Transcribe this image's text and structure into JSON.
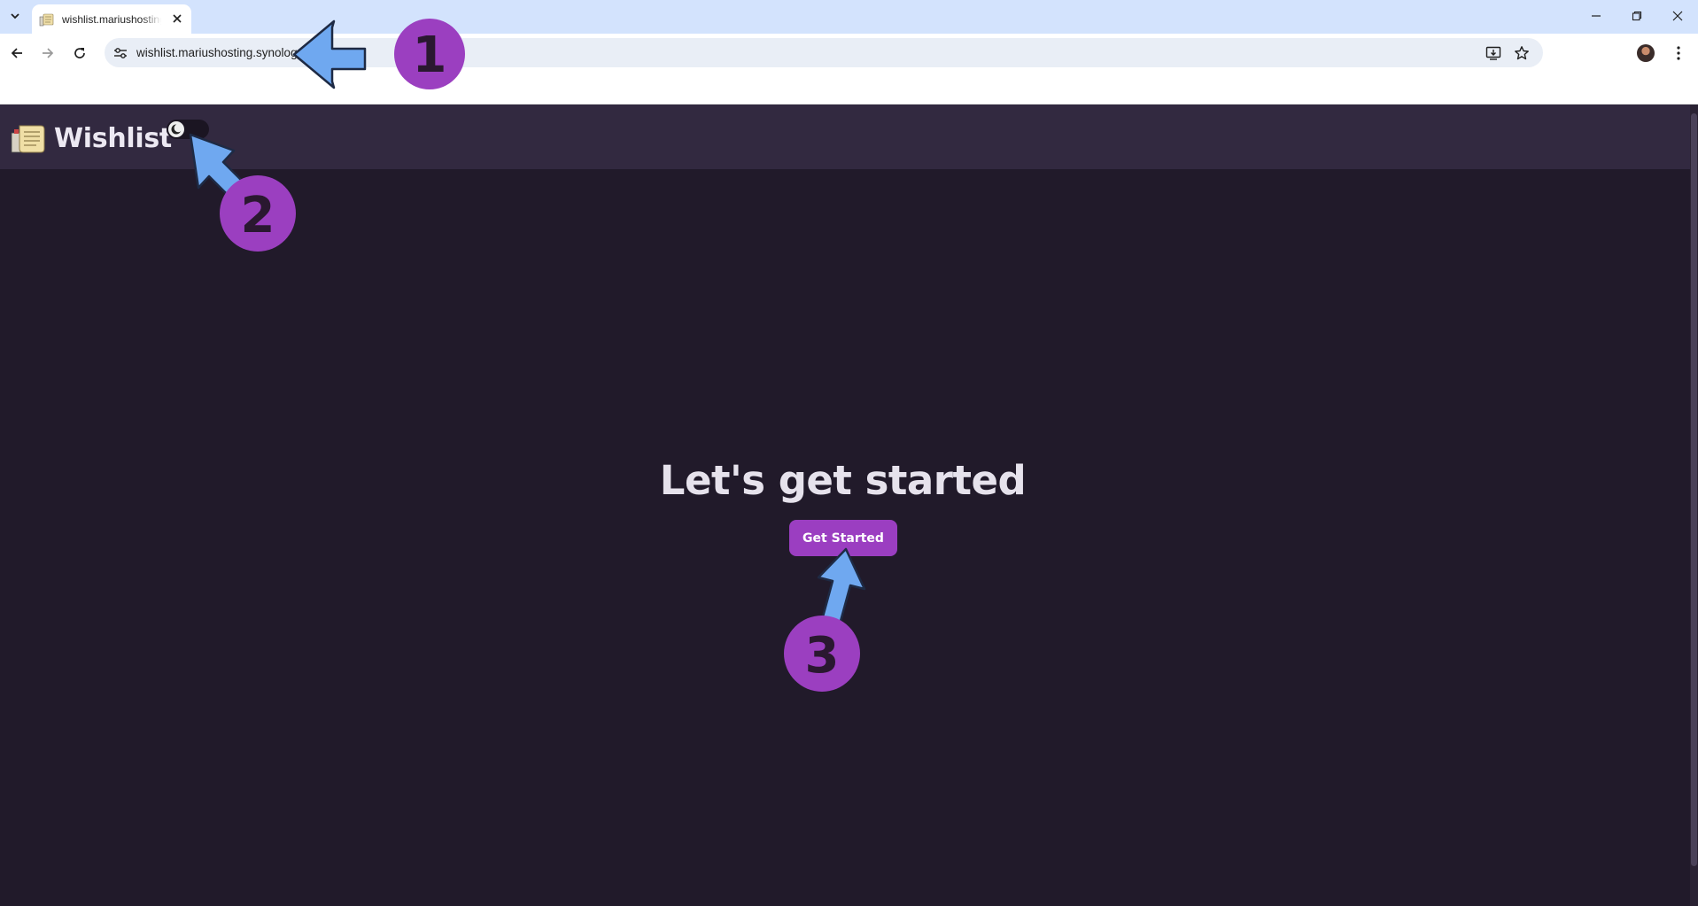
{
  "browser": {
    "tab": {
      "title": "wishlist.mariushosting.synology.me"
    },
    "address_bar": {
      "url": "wishlist.mariushosting.synology.me"
    },
    "icons": [
      "tab-list-icon",
      "favicon-icon",
      "close-icon",
      "minimize-icon",
      "restore-icon",
      "window-close-icon",
      "back-icon",
      "forward-icon",
      "reload-icon",
      "site-settings-icon",
      "install-app-icon",
      "bookmark-star-icon",
      "profile-avatar",
      "more-menu-icon"
    ]
  },
  "app": {
    "name": "Wishlist",
    "theme_toggle": {
      "state": "dark",
      "icon": "moon-icon"
    }
  },
  "main": {
    "heading": "Let's get started",
    "cta_label": "Get Started"
  },
  "annotations": {
    "markers": [
      "1",
      "2",
      "3"
    ],
    "color": "#9b3fc0",
    "arrow_color": "#6fa8f0"
  },
  "colors": {
    "page_bg": "#211a2a",
    "header_bg": "#322940",
    "accent": "#9b3ec1",
    "tabstrip": "#d3e3fd"
  }
}
